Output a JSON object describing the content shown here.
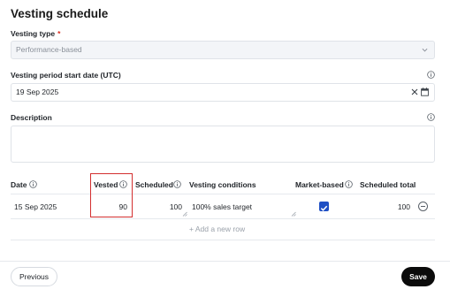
{
  "page": {
    "title": "Vesting schedule"
  },
  "vesting_type": {
    "label": "Vesting type",
    "required_marker": "*",
    "value": "Performance-based",
    "icon": "chevron-down-icon"
  },
  "start_date": {
    "label": "Vesting period start date (UTC)",
    "value": "19 Sep 2025",
    "icons": [
      "info-icon",
      "clear-icon",
      "calendar-icon"
    ]
  },
  "description": {
    "label": "Description",
    "value": "",
    "icon": "info-icon"
  },
  "table": {
    "columns": {
      "date": "Date",
      "vested": "Vested",
      "scheduled": "Scheduled",
      "conditions": "Vesting conditions",
      "market_based": "Market-based",
      "scheduled_total": "Scheduled total"
    },
    "rows": [
      {
        "date": "15 Sep 2025",
        "vested": "90",
        "scheduled": "100",
        "conditions": "100% sales target",
        "market_based": true,
        "scheduled_total": "100"
      }
    ],
    "add_row_label": "+ Add a new row"
  },
  "footer": {
    "previous_label": "Previous",
    "save_label": "Save"
  },
  "colors": {
    "accent": "#1f4fc4",
    "highlight": "#d32f2f",
    "required": "#d92d20",
    "primary_button": "#0b0b0b"
  }
}
